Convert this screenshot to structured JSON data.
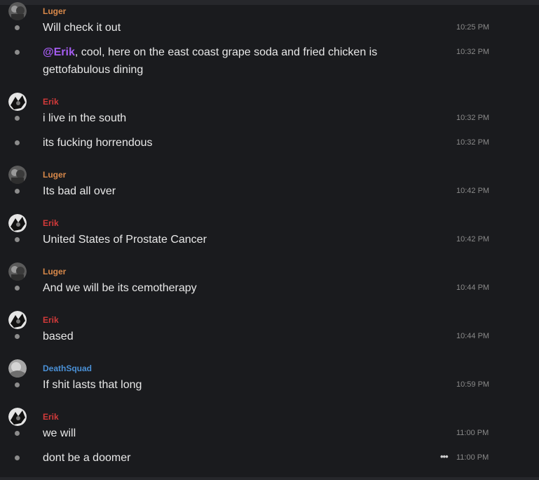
{
  "messages": [
    {
      "user": "Luger",
      "text": "Will check it out",
      "time": "10:25 PM"
    },
    {
      "mention": "@Erik",
      "text": ", cool, here on the east coast grape soda and fried chicken is gettofabulous dining",
      "time": "10:32 PM"
    },
    {
      "user": "Erik",
      "text": "i live in the south",
      "time": "10:32 PM"
    },
    {
      "text": "its fucking horrendous",
      "time": "10:32 PM"
    },
    {
      "user": "Luger",
      "text": "Its bad all over",
      "time": "10:42 PM"
    },
    {
      "user": "Erik",
      "text": "United States of Prostate Cancer",
      "time": "10:42 PM"
    },
    {
      "user": "Luger",
      "text": "And we will be its cemotherapy",
      "time": "10:44 PM"
    },
    {
      "user": "Erik",
      "text": "based",
      "time": "10:44 PM"
    },
    {
      "user": "DeathSquad",
      "text": "If shit lasts that long",
      "time": "10:59 PM"
    },
    {
      "user": "Erik",
      "text": "we will",
      "time": "11:00 PM"
    },
    {
      "text": "dont be a doomer",
      "time": "11:00 PM",
      "more_icon": "ellipsis-icon",
      "more_glyph": "•••"
    }
  ],
  "colors": {
    "background": "#1a1b1e",
    "luger": "#d9894a",
    "erik": "#d23a3a",
    "deathsquad": "#4a90d6",
    "mention": "#a45cf0"
  }
}
